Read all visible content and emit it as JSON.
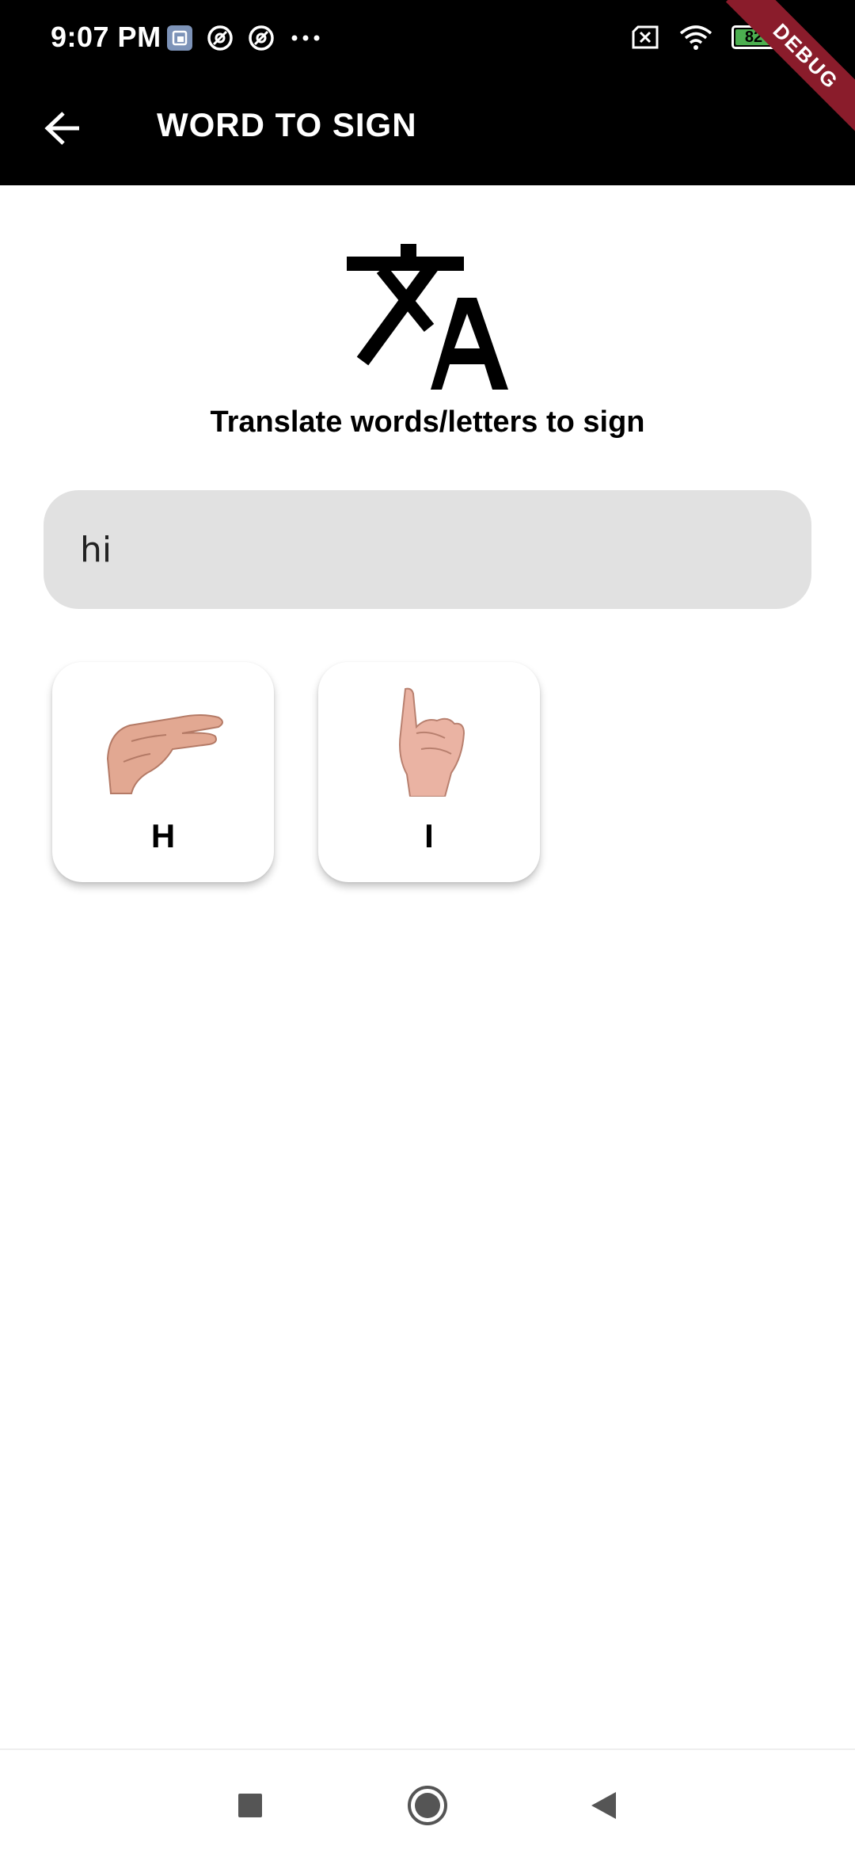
{
  "status_bar": {
    "time": "9:07 PM",
    "battery_level": "82",
    "icons": [
      "gallery-notification-icon",
      "at-sign-icon",
      "at-sign-icon",
      "more-dots-icon",
      "no-sim-icon",
      "wifi-icon",
      "battery-icon"
    ]
  },
  "app_bar": {
    "title": "WORD TO SIGN",
    "back_icon": "arrow-left-icon"
  },
  "debug_banner": "DEBUG",
  "main": {
    "icon": "translate-icon",
    "heading": "Translate words/letters to sign",
    "input_value": "hi",
    "cards": [
      {
        "letter": "H",
        "image": "hand-sign-h"
      },
      {
        "letter": "I",
        "image": "hand-sign-i"
      }
    ]
  },
  "nav_bar": {
    "buttons": [
      "recents-square-icon",
      "home-circle-icon",
      "back-triangle-icon"
    ]
  },
  "colors": {
    "app_bar_bg": "#000000",
    "input_bg": "#e1e1e1",
    "debug_ribbon": "#8a1c2b",
    "battery_green": "#4caf50"
  }
}
